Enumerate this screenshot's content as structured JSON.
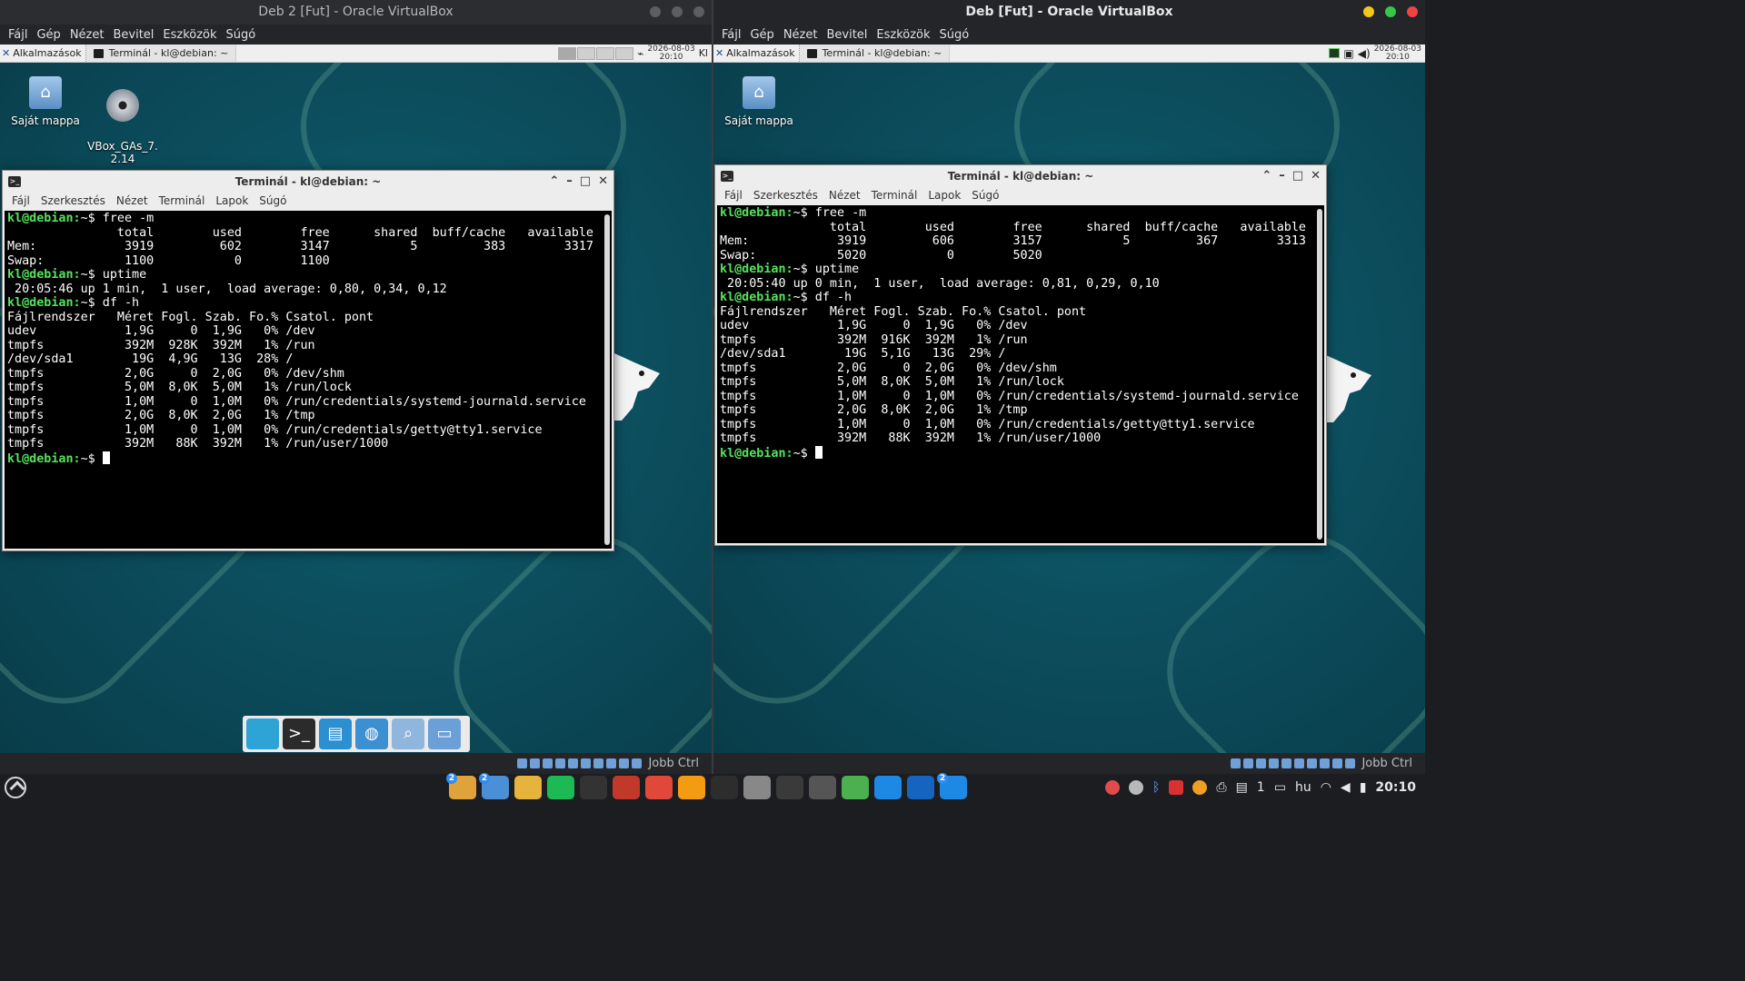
{
  "left_vm": {
    "title": "Deb 2 [Fut] - Oracle VirtualBox",
    "menu": [
      "Fájl",
      "Gép",
      "Nézet",
      "Bevitel",
      "Eszközök",
      "Súgó"
    ],
    "panel": {
      "apps_label": "Alkalmazások",
      "window_label": "Terminál - kl@debian: ~",
      "clock_date": "2026-08-03",
      "clock_time": "20:10",
      "kb": "Kl"
    },
    "desktop_icons": [
      {
        "label": "Saját mappa"
      },
      {
        "label": "VBox_GAs_7.\n2.14"
      }
    ],
    "terminal": {
      "title": "Terminál - kl@debian: ~",
      "menu": [
        "Fájl",
        "Szerkesztés",
        "Nézet",
        "Terminál",
        "Lapok",
        "Súgó"
      ],
      "prompt": "kl@debian:",
      "lines": [
        {
          "prompt": "kl@debian:",
          "text": "~$ free -m"
        },
        {
          "text": "               total        used        free      shared  buff/cache   available"
        },
        {
          "text": "Mem:            3919         602        3147           5         383        3317"
        },
        {
          "text": "Swap:           1100           0        1100"
        },
        {
          "prompt": "kl@debian:",
          "text": "~$ uptime"
        },
        {
          "text": " 20:05:46 up 1 min,  1 user,  load average: 0,80, 0,34, 0,12"
        },
        {
          "prompt": "kl@debian:",
          "text": "~$ df -h"
        },
        {
          "text": "Fájlrendszer   Méret Fogl. Szab. Fo.% Csatol. pont"
        },
        {
          "text": "udev            1,9G     0  1,9G   0% /dev"
        },
        {
          "text": "tmpfs           392M  928K  392M   1% /run"
        },
        {
          "text": "/dev/sda1        19G  4,9G   13G  28% /"
        },
        {
          "text": "tmpfs           2,0G     0  2,0G   0% /dev/shm"
        },
        {
          "text": "tmpfs           5,0M  8,0K  5,0M   1% /run/lock"
        },
        {
          "text": "tmpfs           1,0M     0  1,0M   0% /run/credentials/systemd-journald.service"
        },
        {
          "text": "tmpfs           2,0G  8,0K  2,0G   1% /tmp"
        },
        {
          "text": "tmpfs           1,0M     0  1,0M   0% /run/credentials/getty@tty1.service"
        },
        {
          "text": "tmpfs           392M   88K  392M   1% /run/user/1000"
        },
        {
          "prompt": "kl@debian:",
          "text": "~$ ",
          "cursor": true
        }
      ]
    },
    "host_key": "Jobb Ctrl"
  },
  "right_vm": {
    "title": "Deb [Fut] - Oracle VirtualBox",
    "menu": [
      "Fájl",
      "Gép",
      "Nézet",
      "Bevitel",
      "Eszközök",
      "Súgó"
    ],
    "panel": {
      "apps_label": "Alkalmazások",
      "window_label": "Terminál - kl@debian: ~",
      "clock_date": "2026-08-03",
      "clock_time": "20:10"
    },
    "desktop_icons": [
      {
        "label": "Saját mappa"
      }
    ],
    "terminal": {
      "title": "Terminál - kl@debian: ~",
      "menu": [
        "Fájl",
        "Szerkesztés",
        "Nézet",
        "Terminál",
        "Lapok",
        "Súgó"
      ],
      "lines": [
        {
          "prompt": "kl@debian:",
          "text": "~$ free -m"
        },
        {
          "text": "               total        used        free      shared  buff/cache   available"
        },
        {
          "text": "Mem:            3919         606        3157           5         367        3313"
        },
        {
          "text": "Swap:           5020           0        5020"
        },
        {
          "prompt": "kl@debian:",
          "text": "~$ uptime"
        },
        {
          "text": " 20:05:40 up 0 min,  1 user,  load average: 0,81, 0,29, 0,10"
        },
        {
          "prompt": "kl@debian:",
          "text": "~$ df -h"
        },
        {
          "text": "Fájlrendszer   Méret Fogl. Szab. Fo.% Csatol. pont"
        },
        {
          "text": "udev            1,9G     0  1,9G   0% /dev"
        },
        {
          "text": "tmpfs           392M  916K  392M   1% /run"
        },
        {
          "text": "/dev/sda1        19G  5,1G   13G  29% /"
        },
        {
          "text": "tmpfs           2,0G     0  2,0G   0% /dev/shm"
        },
        {
          "text": "tmpfs           5,0M  8,0K  5,0M   1% /run/lock"
        },
        {
          "text": "tmpfs           1,0M     0  1,0M   0% /run/credentials/systemd-journald.service"
        },
        {
          "text": "tmpfs           2,0G  8,0K  2,0G   1% /tmp"
        },
        {
          "text": "tmpfs           1,0M     0  1,0M   0% /run/credentials/getty@tty1.service"
        },
        {
          "text": "tmpfs           392M   88K  392M   1% /run/user/1000"
        },
        {
          "prompt": "kl@debian:",
          "text": "~$ ",
          "cursor": true
        }
      ]
    },
    "host_key": "Jobb Ctrl"
  },
  "host_taskbar": {
    "apps": [
      {
        "name": "mail-icon",
        "color": "#e0a23a",
        "badge": "2"
      },
      {
        "name": "chat-icon",
        "color": "#4b8fd6",
        "badge": "2"
      },
      {
        "name": "files-icon",
        "color": "#e6b43c"
      },
      {
        "name": "spotify-icon",
        "color": "#1db954"
      },
      {
        "name": "timer-icon",
        "color": "#333333"
      },
      {
        "name": "presentation-icon",
        "color": "#c0392b"
      },
      {
        "name": "toolbox-icon",
        "color": "#e0483a"
      },
      {
        "name": "sync-icon",
        "color": "#f39c12"
      },
      {
        "name": "terminal-icon",
        "color": "#2d2d2d"
      },
      {
        "name": "mixer-icon",
        "color": "#888888"
      },
      {
        "name": "davinci-icon",
        "color": "#3a3a3a"
      },
      {
        "name": "calculator-icon",
        "color": "#555555"
      },
      {
        "name": "layers-icon",
        "color": "#4caf50"
      },
      {
        "name": "monitor-icon",
        "color": "#1e88e5"
      },
      {
        "name": "bluetooth-icon",
        "color": "#1565c0"
      },
      {
        "name": "virtualbox-icon",
        "color": "#1e88e5",
        "badge": "2"
      }
    ],
    "tray": {
      "lang": "hu",
      "count": "1",
      "time": "20:10"
    }
  }
}
